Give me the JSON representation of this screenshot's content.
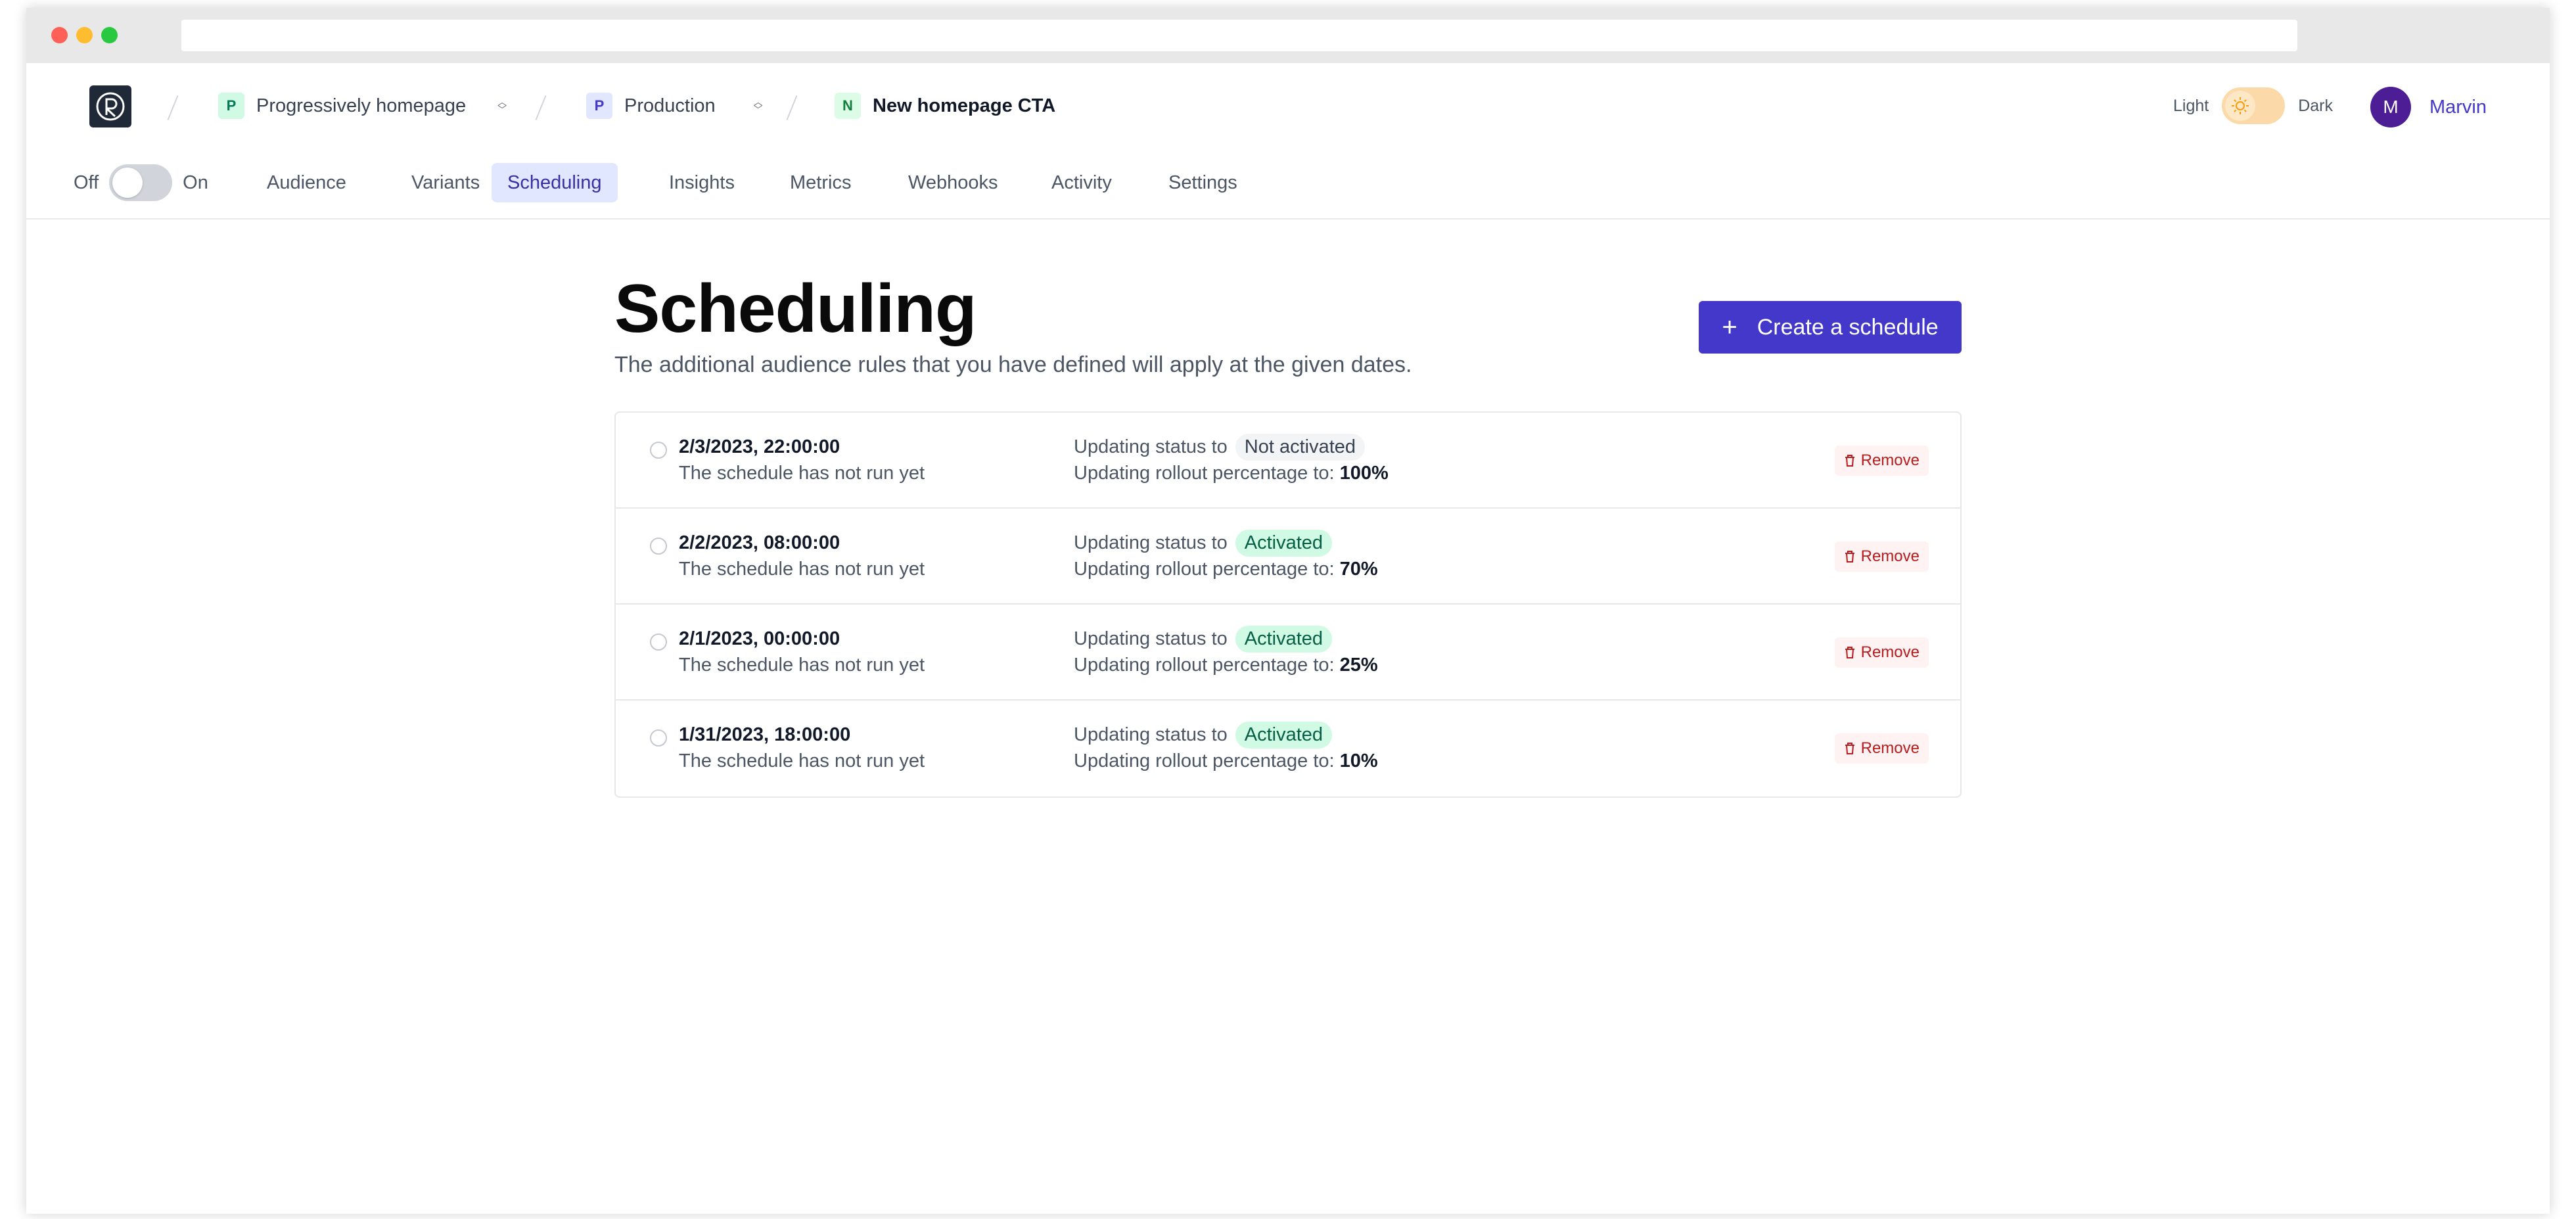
{
  "breadcrumb": {
    "project": {
      "badge": "P",
      "label": "Progressively homepage"
    },
    "environment": {
      "badge": "P",
      "label": "Production"
    },
    "flag": {
      "badge": "N",
      "label": "New homepage CTA"
    }
  },
  "theme": {
    "light_label": "Light",
    "dark_label": "Dark"
  },
  "user": {
    "initial": "M",
    "name": "Marvin"
  },
  "flag_toggle": {
    "off_label": "Off",
    "on_label": "On"
  },
  "tabs": [
    "Audience",
    "Variants",
    "Scheduling",
    "Insights",
    "Metrics",
    "Webhooks",
    "Activity",
    "Settings"
  ],
  "active_tab": "Scheduling",
  "page": {
    "title": "Scheduling",
    "subtitle": "The additional audience rules that you have defined will apply at the given dates.",
    "create_button": "Create a schedule"
  },
  "schedule_labels": {
    "status_prefix": "Updating status to",
    "rollout_prefix": "Updating rollout percentage to:",
    "remove": "Remove"
  },
  "schedules": [
    {
      "date": "2/3/2023, 22:00:00",
      "run_state": "The schedule has not run yet",
      "status": "Not activated",
      "rollout": "100%"
    },
    {
      "date": "2/2/2023, 08:00:00",
      "run_state": "The schedule has not run yet",
      "status": "Activated",
      "rollout": "70%"
    },
    {
      "date": "2/1/2023, 00:00:00",
      "run_state": "The schedule has not run yet",
      "status": "Activated",
      "rollout": "25%"
    },
    {
      "date": "1/31/2023, 18:00:00",
      "run_state": "The schedule has not run yet",
      "status": "Activated",
      "rollout": "10%"
    }
  ],
  "colors": {
    "primary": "#4338ca",
    "activated_bg": "#d1fae5",
    "not_activated_bg": "#f3f4f6",
    "remove_text": "#b91c1c"
  }
}
